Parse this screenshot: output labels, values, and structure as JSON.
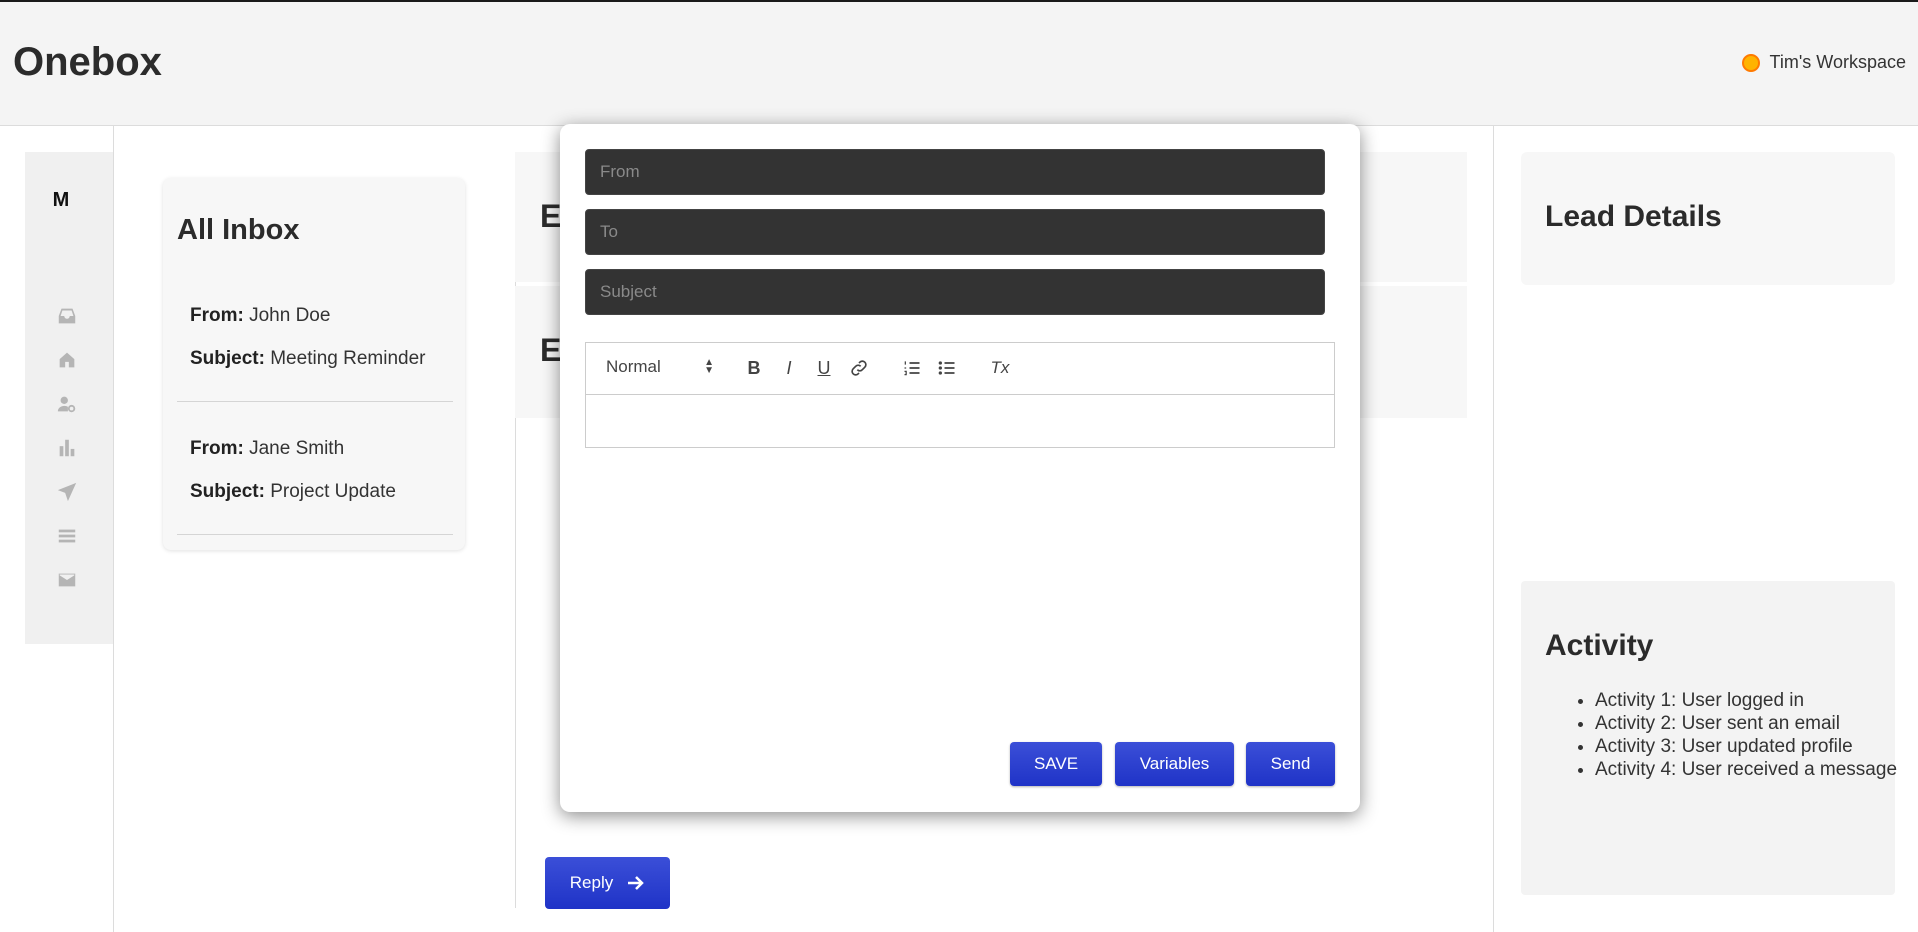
{
  "header": {
    "app_title": "Onebox",
    "workspace_label": "Tim's Workspace",
    "workspace_dot_color": "#ffb300"
  },
  "rail": {
    "logo_text": "M",
    "icons": [
      "inbox-tray-icon",
      "home-icon",
      "user-search-icon",
      "bar-chart-icon",
      "send-icon",
      "list-icon",
      "mail-icon"
    ]
  },
  "inbox": {
    "title": "All Inbox",
    "from_label": "From:",
    "subject_label": "Subject:",
    "items": [
      {
        "from": "John Doe",
        "subject": "Meeting Reminder"
      },
      {
        "from": "Jane Smith",
        "subject": "Project Update"
      }
    ]
  },
  "background_panel": {
    "peek_1": "E",
    "peek_2": "E"
  },
  "compose": {
    "from_placeholder": "From",
    "to_placeholder": "To",
    "subject_placeholder": "Subject",
    "format_select_value": "Normal",
    "toolbar_bold": "B",
    "toolbar_italic": "I",
    "toolbar_underline": "U",
    "toolbar_clear": "Tx",
    "save_label": "SAVE",
    "variables_label": "Variables",
    "send_label": "Send"
  },
  "reply": {
    "label": "Reply"
  },
  "lead": {
    "title": "Lead Details"
  },
  "activity": {
    "title": "Activity",
    "items": [
      "Activity 1: User logged in",
      "Activity 2: User sent an email",
      "Activity 3: User updated profile",
      "Activity 4: User received a message"
    ]
  },
  "colors": {
    "accent": "#2a3fd0",
    "field_bg": "#333333"
  }
}
